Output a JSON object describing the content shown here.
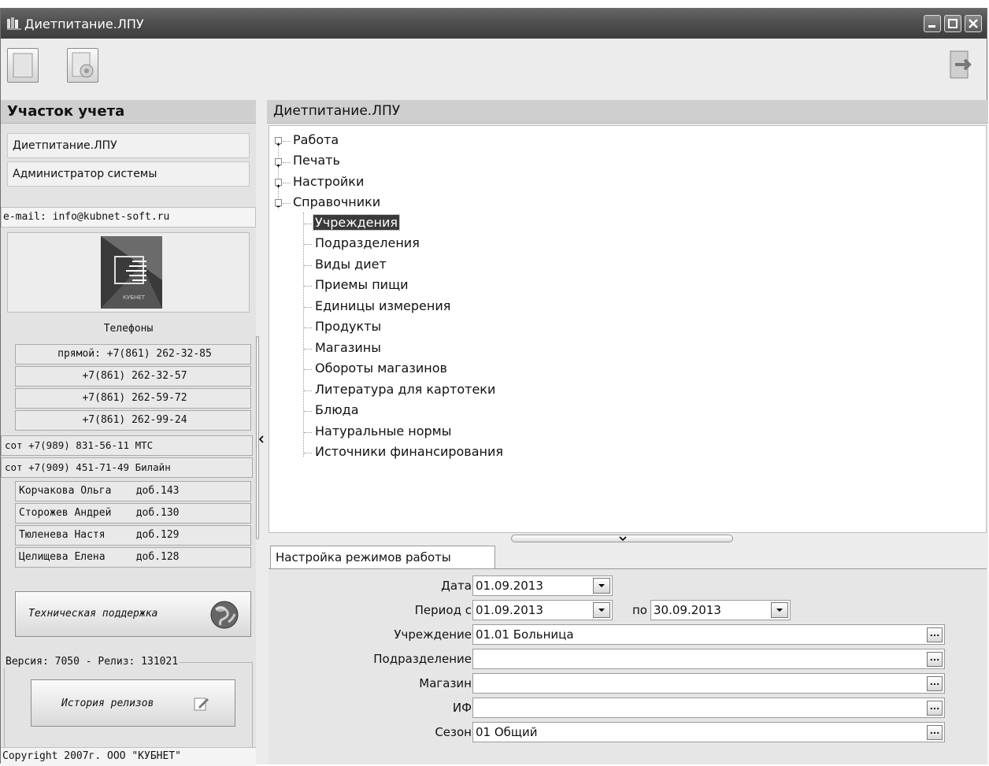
{
  "window": {
    "title": "Диетпитание.ЛПУ"
  },
  "left": {
    "header": "Участок учета",
    "account_items": [
      "Диетпитание.ЛПУ",
      "Администратор системы"
    ],
    "email": "e-mail: info@kubnet-soft.ru",
    "logo_text": "КУБНЕТ",
    "phones_title": "Телефоны",
    "phones": [
      "прямой: +7(861) 262-32-85",
      "+7(861) 262-32-57",
      "+7(861) 262-59-72",
      "+7(861) 262-99-24",
      "сот +7(989) 831-56-11 МТС",
      "сот +7(909) 451-71-49 Билайн",
      "Корчакова Ольга    доб.143",
      "Сторожев Андрей    доб.130",
      "Тюленева Настя     доб.129",
      "Целищева Елена     доб.128"
    ],
    "support_label": "Техническая поддержка",
    "version": "Версия: 7050 - Релиз: 131021",
    "history_label": "История релизов",
    "copyright": "Copyright 2007г. ООО \"КУБНЕТ\""
  },
  "right": {
    "header": "Диетпитание.ЛПУ",
    "tree": {
      "nodes": [
        "Работа",
        "Печать",
        "Настройки",
        "Справочники"
      ],
      "children": [
        "Учреждения",
        "Подразделения",
        "Виды диет",
        "Приемы пищи",
        "Единицы измерения",
        "Продукты",
        "Магазины",
        "Обороты магазинов",
        "Литература для картотеки",
        "Блюда",
        "Натуральные нормы",
        "Источники финансирования"
      ]
    },
    "tab_label": "Настройка режимов работы",
    "form": {
      "date_label": "Дата",
      "date_value": "01.09.2013",
      "period_label": "Период с",
      "period_from": "01.09.2013",
      "period_to_label": "по",
      "period_to": "30.09.2013",
      "institution_label": "Учреждение",
      "institution_value": "01.01 Больница",
      "division_label": "Подразделение",
      "division_value": "",
      "shop_label": "Магазин",
      "shop_value": "",
      "if_label": "ИФ",
      "if_value": "",
      "season_label": "Сезон",
      "season_value": "01 Общий"
    }
  },
  "colors": {
    "titlebar": "#4f4f4f",
    "selection": "#3a3a3a",
    "panel_header": "#cfcfcf"
  }
}
